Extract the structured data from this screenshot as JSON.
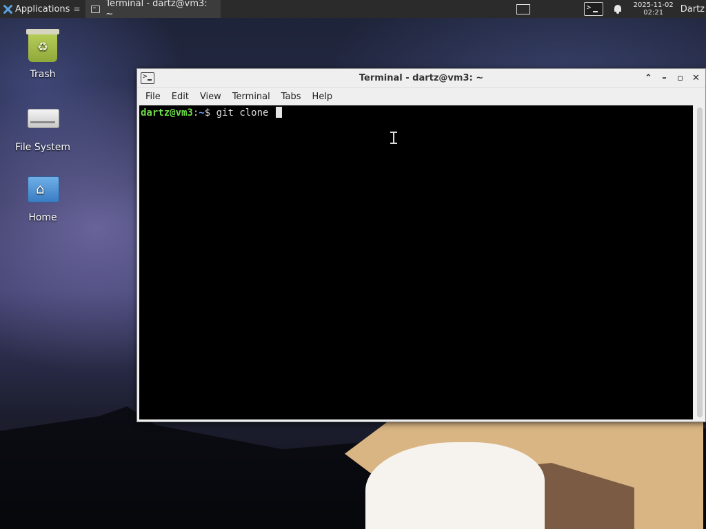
{
  "panel": {
    "applications_label": "Applications",
    "applications_sep": "≡",
    "task_title": "Terminal - dartz@vm3: ~",
    "clock_date": "2025-11-02",
    "clock_time": "02:21",
    "user": "Dartz"
  },
  "desktop": {
    "icons": [
      {
        "label": "Trash",
        "icon": "trash-icon"
      },
      {
        "label": "File System",
        "icon": "drive-icon"
      },
      {
        "label": "Home",
        "icon": "home-folder-icon"
      }
    ]
  },
  "window": {
    "title": "Terminal - dartz@vm3: ~",
    "buttons": {
      "shade": "⌃",
      "minimize": "–",
      "maximize": "▫",
      "close": "✕"
    },
    "menu": [
      "File",
      "Edit",
      "View",
      "Terminal",
      "Tabs",
      "Help"
    ]
  },
  "terminal": {
    "prompt_user": "dartz@vm3",
    "prompt_colon": ":",
    "prompt_path": "~",
    "prompt_symbol": "$",
    "command": "git clone "
  }
}
